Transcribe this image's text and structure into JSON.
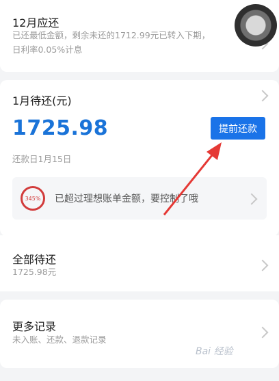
{
  "card_dec": {
    "title": "12月应还",
    "desc_line1": "已还最低金额，剩余未还的1712.99元已转入下期，",
    "desc_line2": "日利率0.05%计息"
  },
  "card_jan": {
    "title": "1月待还(元)",
    "amount": "1725.98",
    "prepay_label": "提前还款",
    "due": "还款日1月15日",
    "ring_label": "345%",
    "notice": "已超过理想账单金额，要控制了哦"
  },
  "card_all": {
    "title": "全部待还",
    "amount": "1725.98元"
  },
  "card_more": {
    "title": "更多记录",
    "desc": "未入账、还款、退款记录"
  },
  "watermark": "Bai 经验"
}
